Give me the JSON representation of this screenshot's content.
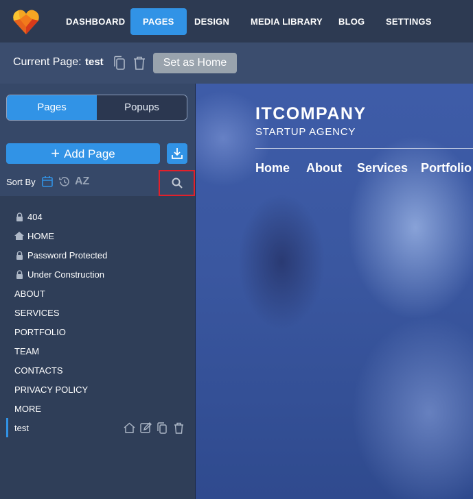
{
  "topnav": {
    "items": [
      {
        "label": "DASHBOARD",
        "active": false
      },
      {
        "label": "PAGES",
        "active": true
      },
      {
        "label": "DESIGN",
        "active": false
      },
      {
        "label": "MEDIA LIBRARY",
        "active": false
      },
      {
        "label": "BLOG",
        "active": false
      },
      {
        "label": "SETTINGS",
        "active": false
      }
    ],
    "logo_icon": "heart-logo-icon"
  },
  "pagebar": {
    "current_label": "Current Page:",
    "current_value": "test",
    "set_home_label": "Set as Home",
    "icons": [
      "copy-icon",
      "trash-icon"
    ]
  },
  "sidebar": {
    "tabs": [
      {
        "label": "Pages",
        "active": true
      },
      {
        "label": "Popups",
        "active": false
      }
    ],
    "add_page_label": "Add Page",
    "sort_label": "Sort By",
    "sort_options": [
      "calendar-icon",
      "history-icon",
      "AZ"
    ],
    "sort_az_label": "AZ",
    "pages": [
      {
        "label": "404",
        "icon": "lock-icon"
      },
      {
        "label": "HOME",
        "icon": "home-icon"
      },
      {
        "label": "Password Protected",
        "icon": "lock-icon"
      },
      {
        "label": "Under Construction",
        "icon": "lock-icon"
      },
      {
        "label": "ABOUT",
        "icon": ""
      },
      {
        "label": "SERVICES",
        "icon": ""
      },
      {
        "label": "PORTFOLIO",
        "icon": ""
      },
      {
        "label": "TEAM",
        "icon": ""
      },
      {
        "label": "CONTACTS",
        "icon": ""
      },
      {
        "label": "PRIVACY POLICY",
        "icon": ""
      },
      {
        "label": "MORE",
        "icon": ""
      },
      {
        "label": "test",
        "icon": "",
        "selected": true
      }
    ]
  },
  "preview": {
    "brand": "ITCOMPANY",
    "tagline": "STARTUP AGENCY",
    "nav": [
      "Home",
      "About",
      "Services",
      "Portfolio"
    ]
  },
  "colors": {
    "accent": "#3193e6",
    "nav_bg": "#2d3a52",
    "bar_bg": "#3b4d6e",
    "highlight": "#e3202a"
  }
}
